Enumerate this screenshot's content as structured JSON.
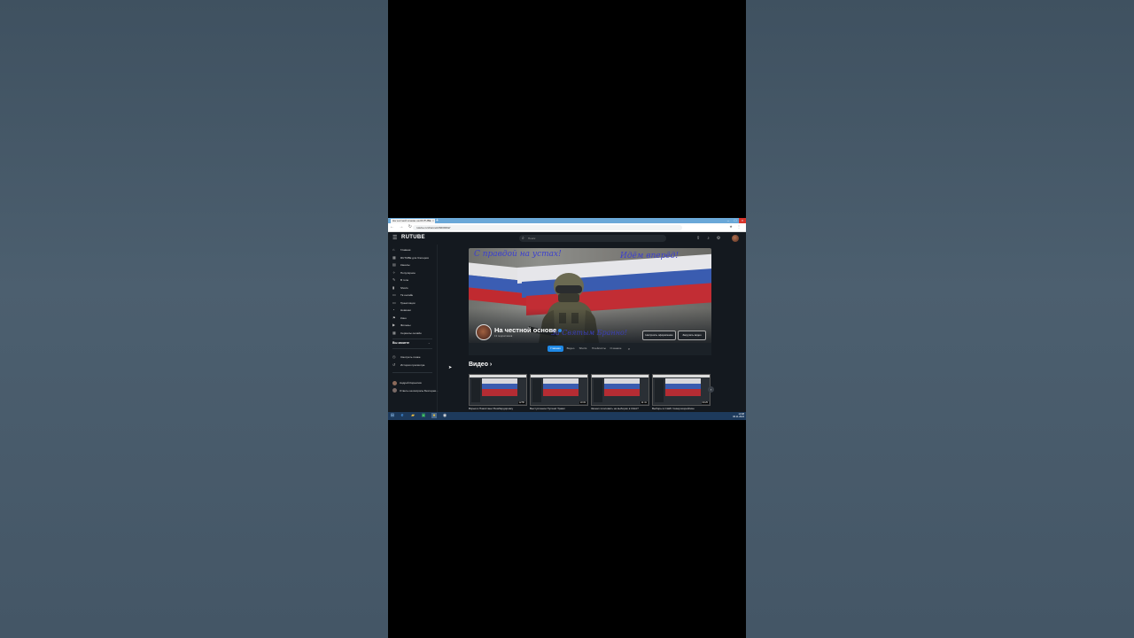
{
  "browser": {
    "tab_title": "На честной основе на RUTUBE",
    "tab_close": "×",
    "new_tab": "+",
    "url": "rutube.ru/channel/26609392/",
    "nav": "← → ↻",
    "window_controls": [
      "–",
      "□",
      "×"
    ]
  },
  "header": {
    "menu_icon": "☰",
    "logo": "RUTUBE",
    "search_placeholder": "Поиск",
    "icons": [
      "upload-icon",
      "notifications-icon",
      "apps-icon"
    ]
  },
  "sidebar": {
    "items": [
      {
        "icon": "⌂",
        "label": "Главная"
      },
      {
        "icon": "▦",
        "label": "RUTUBE для блогеров"
      },
      {
        "icon": "▤",
        "label": "Каналы"
      },
      {
        "icon": "✧",
        "label": "Популярное"
      },
      {
        "icon": "✎",
        "label": "В топе"
      },
      {
        "icon": "▮",
        "label": "Shorts"
      },
      {
        "icon": "▭",
        "label": "Тв онлайн"
      },
      {
        "icon": "▭",
        "label": "Трансляции"
      },
      {
        "icon": "◔",
        "label": "Новинки"
      },
      {
        "icon": "⚑",
        "label": "Кино"
      },
      {
        "icon": "▶",
        "label": "Фильмы"
      },
      {
        "icon": "▦",
        "label": "Сериалы онлайн"
      }
    ],
    "section_title": "Вы можете",
    "section_items": [
      {
        "icon": "◷",
        "label": "Смотреть позже"
      },
      {
        "icon": "↺",
        "label": "История просмотра"
      }
    ],
    "subscriptions": [
      {
        "label": "Андрей Корнилов",
        "color": "#8c6a5a"
      },
      {
        "label": "Ответы на вопросы Бехтерев...",
        "color": "#7a6a66"
      }
    ]
  },
  "channel": {
    "banner_text_left": "С правдой на устах!",
    "banner_text_right": "Идём вперёд!",
    "banner_text_bottom": "За Святым Бранно!",
    "name": "На честной основе",
    "subscribers": "13 подписчиков",
    "btn_manage": "Настроить оформление",
    "btn_upload": "Загрузить видео",
    "tabs": [
      "Главная",
      "Видео",
      "Shorts",
      "Плейлисты",
      "О канале"
    ],
    "active_tab": "Главная"
  },
  "videos": {
    "heading": "Видео",
    "items": [
      {
        "title": "Взрыв в Пакистане! Бомбардировку",
        "duration": "12:55"
      },
      {
        "title": "Выступление Путина! Трамп",
        "duration": "10:33"
      },
      {
        "title": "Зачем голосовать на выборах в США?",
        "duration": "11:41"
      },
      {
        "title": "Выборы в США! Северокорейские",
        "duration": "09:25"
      }
    ],
    "next_icon": "›"
  },
  "taskbar": {
    "time": "13:38",
    "date": "06.11.2024"
  },
  "colors": {
    "accent": "#1e88e5",
    "background": "#14191f"
  }
}
